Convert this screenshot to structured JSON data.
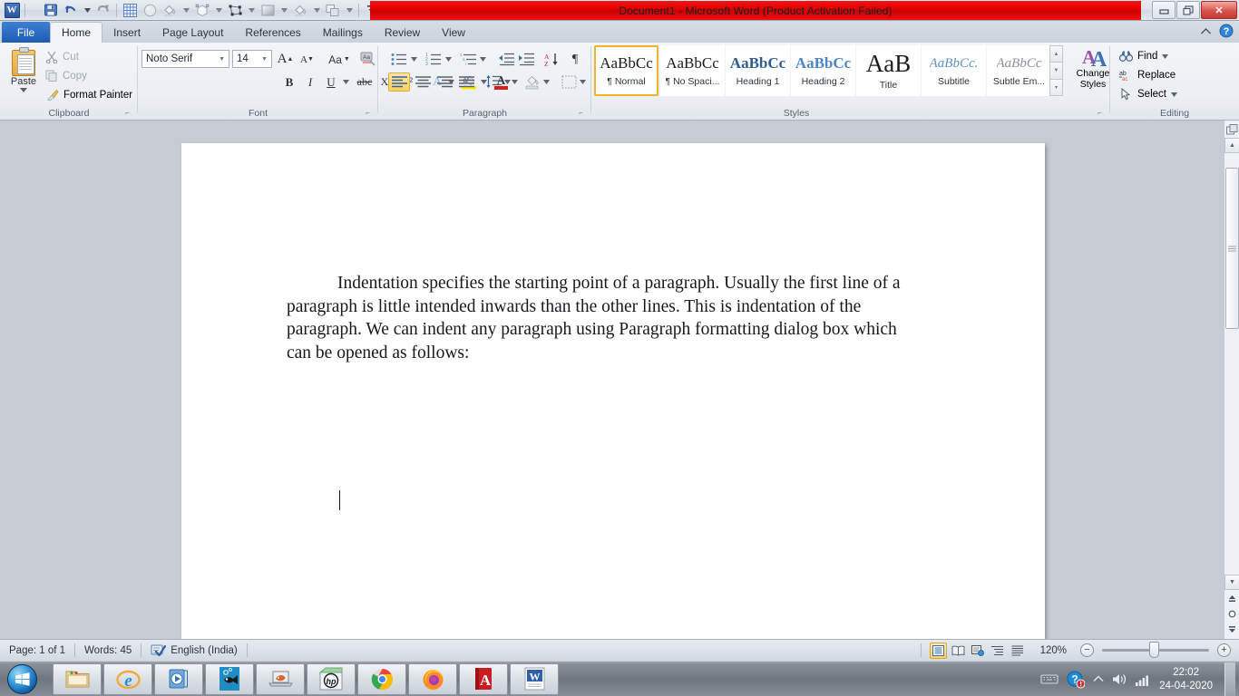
{
  "window": {
    "title": "Document1  -  Microsoft Word (Product Activation Failed)",
    "minimize_label": "—",
    "restore_label": "❐",
    "close_label": "✕",
    "app_logo_text": "W"
  },
  "quick_access": {
    "items": [
      {
        "name": "save-icon",
        "label": "Save"
      },
      {
        "name": "undo-icon",
        "label": "Undo"
      },
      {
        "name": "redo-icon",
        "label": "Redo"
      },
      {
        "name": "table-grid-icon",
        "label": "Table"
      },
      {
        "name": "sphere-icon",
        "label": "3D Object"
      },
      {
        "name": "paint-bucket-icon",
        "label": "Fill Color"
      },
      {
        "name": "transform-icon",
        "label": "Transform"
      },
      {
        "name": "shape-points-icon",
        "label": "Edit Points"
      },
      {
        "name": "gradient-icon",
        "label": "Gradient"
      },
      {
        "name": "fill-icon",
        "label": "Fill"
      },
      {
        "name": "duplicate-icon",
        "label": "Duplicate"
      },
      {
        "name": "customize-qat-icon",
        "label": "Customize Quick Access Toolbar"
      }
    ]
  },
  "tabs": [
    {
      "label": "File",
      "active": false,
      "file": true
    },
    {
      "label": "Home",
      "active": true
    },
    {
      "label": "Insert",
      "active": false
    },
    {
      "label": "Page Layout",
      "active": false
    },
    {
      "label": "References",
      "active": false
    },
    {
      "label": "Mailings",
      "active": false
    },
    {
      "label": "Review",
      "active": false
    },
    {
      "label": "View",
      "active": false
    }
  ],
  "ribbon": {
    "clipboard": {
      "title": "Clipboard",
      "paste_label": "Paste",
      "cut_label": "Cut",
      "copy_label": "Copy",
      "format_painter_label": "Format Painter"
    },
    "font": {
      "title": "Font",
      "font_name": "Noto Serif",
      "font_size": "14",
      "grow_label": "A",
      "shrink_label": "A",
      "change_case_label": "Aa",
      "clear_formatting_label": "Aa",
      "bold_label": "B",
      "italic_label": "I",
      "underline_label": "U",
      "strikethrough_label": "abc",
      "subscript_label": "X₂",
      "superscript_label": "X²",
      "text_effects_label": "A",
      "highlight_label": "ab",
      "font_color_label": "A"
    },
    "paragraph": {
      "title": "Paragraph",
      "bullets_label": "Bullets",
      "numbering_label": "Numbering",
      "multilevel_label": "Multilevel List",
      "decrease_indent_label": "Decrease Indent",
      "increase_indent_label": "Increase Indent",
      "sort_label": "Sort",
      "show_marks_label": "¶",
      "align_left_label": "Align Left",
      "center_label": "Center",
      "align_right_label": "Align Right",
      "justify_label": "Justify",
      "line_spacing_label": "Line Spacing",
      "shading_label": "Shading",
      "borders_label": "Borders"
    },
    "styles": {
      "title": "Styles",
      "change_styles_label_1": "Change",
      "change_styles_label_2": "Styles",
      "items": [
        {
          "preview": "AaBbCc",
          "name": "¶ Normal",
          "selected": true,
          "cls": "normal"
        },
        {
          "preview": "AaBbCc",
          "name": "¶ No Spaci...",
          "selected": false,
          "cls": "nospace"
        },
        {
          "preview": "AaBbCc",
          "name": "Heading 1",
          "selected": false,
          "cls": "h1"
        },
        {
          "preview": "AaBbCc",
          "name": "Heading 2",
          "selected": false,
          "cls": "h2"
        },
        {
          "preview": "AaB",
          "name": "Title",
          "selected": false,
          "cls": "title"
        },
        {
          "preview": "AaBbCc.",
          "name": "Subtitle",
          "selected": false,
          "cls": "subtitle"
        },
        {
          "preview": "AaBbCc",
          "name": "Subtle Em...",
          "selected": false,
          "cls": "subtle"
        }
      ]
    },
    "editing": {
      "title": "Editing",
      "find_label": "Find",
      "replace_label": "Replace",
      "select_label": "Select"
    }
  },
  "document": {
    "paragraph": "Indentation specifies the starting point of a paragraph. Usually the first line of a paragraph is little intended inwards than the other lines. This is indentation of the paragraph. We can indent any paragraph using Paragraph formatting dialog box which can be opened as follows:"
  },
  "status_bar": {
    "page_label": "Page: 1 of 1",
    "words_label": "Words: 45",
    "language_label": "English (India)",
    "zoom_label": "120%",
    "zoom_out_label": "−",
    "zoom_in_label": "+",
    "views": [
      {
        "name": "print-layout-view",
        "selected": true
      },
      {
        "name": "full-screen-reading-view",
        "selected": false
      },
      {
        "name": "web-layout-view",
        "selected": false
      },
      {
        "name": "outline-view",
        "selected": false
      },
      {
        "name": "draft-view",
        "selected": false
      }
    ]
  },
  "taskbar": {
    "start_label": "Start",
    "items": [
      {
        "name": "file-explorer-icon",
        "label": "File Explorer"
      },
      {
        "name": "internet-explorer-icon",
        "label": "Internet Explorer"
      },
      {
        "name": "windows-media-player-icon",
        "label": "Windows Media Player"
      },
      {
        "name": "fish-wallpaper-icon",
        "label": "Photos"
      },
      {
        "name": "laptop-icon",
        "label": "Device"
      },
      {
        "name": "hp-icon",
        "label": "HP Support"
      },
      {
        "name": "google-chrome-icon",
        "label": "Google Chrome"
      },
      {
        "name": "firefox-icon",
        "label": "Mozilla Firefox"
      },
      {
        "name": "adobe-reader-icon",
        "label": "Adobe Reader"
      },
      {
        "name": "word-icon",
        "label": "Microsoft Word"
      }
    ],
    "tray": {
      "keyboard_label": "Keyboard",
      "action_center_label": "Action Center",
      "show_hidden_label": "Show hidden icons",
      "volume_label": "Volume",
      "network_label": "Network",
      "time": "22:02",
      "date": "24-04-2020"
    }
  },
  "colors": {
    "title_bar_red": "#e50000",
    "file_tab_blue": "#1c5cb5",
    "accent_gold": "#f0b429",
    "heading_blue": "#3a6ea5",
    "taskbar_gray": "#78808a"
  }
}
